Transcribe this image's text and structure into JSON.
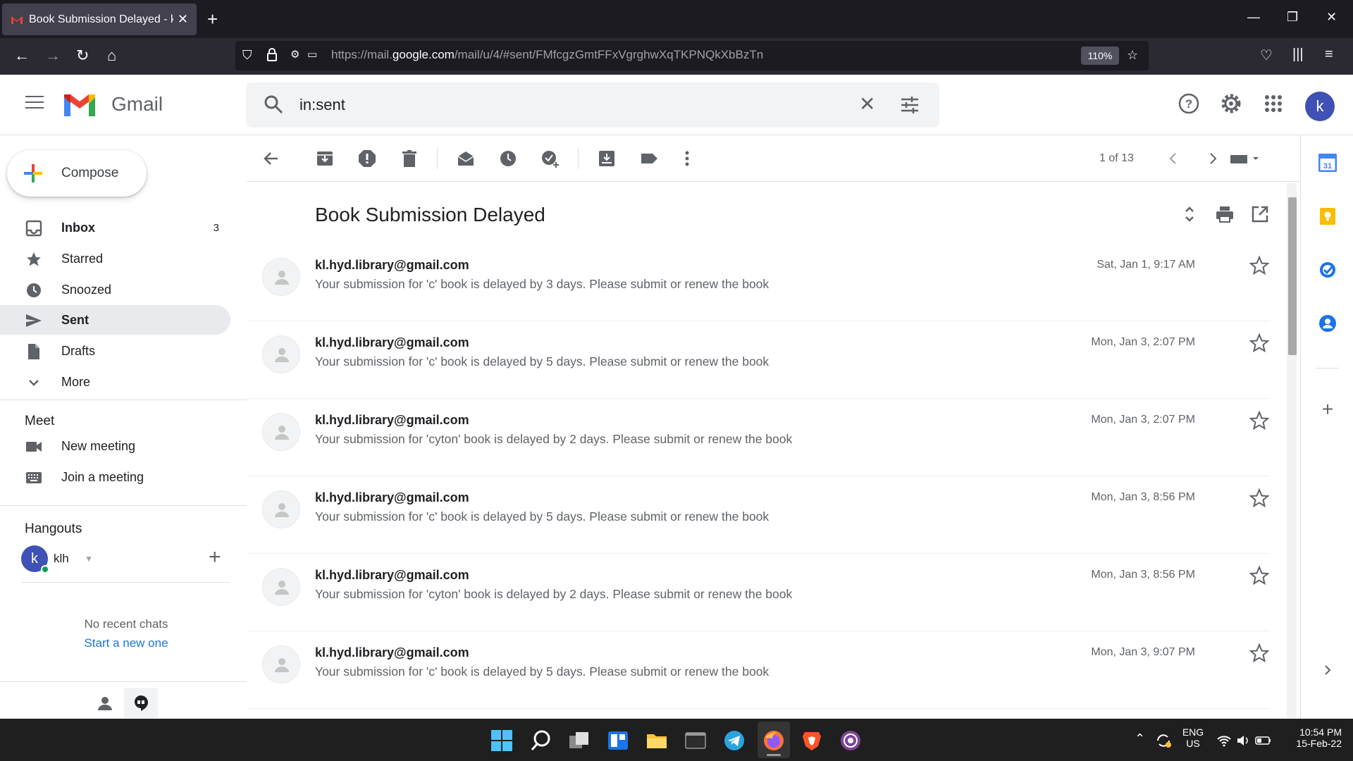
{
  "browser": {
    "tab_title": "Book Submission Delayed - kl.h",
    "url_host_prefix": "https://mail.",
    "url_host": "google.com",
    "url_path": "/mail/u/4/#sent/FMfcgzGmtFFxVgrghwXqTKPNQkXbBzTn",
    "zoom": "110%"
  },
  "gmail": {
    "app_name": "Gmail",
    "search_value": "in:sent",
    "avatar_letter": "k"
  },
  "compose_label": "Compose",
  "nav": [
    {
      "label": "Inbox",
      "count": "3",
      "icon": "inbox-icon"
    },
    {
      "label": "Starred",
      "count": "",
      "icon": "star-icon"
    },
    {
      "label": "Snoozed",
      "count": "",
      "icon": "clock-icon"
    },
    {
      "label": "Sent",
      "count": "",
      "icon": "send-icon"
    },
    {
      "label": "Drafts",
      "count": "",
      "icon": "draft-icon"
    },
    {
      "label": "More",
      "count": "",
      "icon": "chevron-down-icon"
    }
  ],
  "meet": {
    "heading": "Meet",
    "new_meeting": "New meeting",
    "join_meeting": "Join a meeting"
  },
  "hangouts": {
    "heading": "Hangouts",
    "user_name": "klh",
    "user_letter": "k",
    "no_recent": "No recent chats",
    "start_new": "Start a new one"
  },
  "toolbar": {
    "pager": "1 of 13"
  },
  "thread": {
    "subject": "Book Submission Delayed",
    "messages": [
      {
        "from": "kl.hyd.library@gmail.com",
        "snippet": "Your submission for 'c' book is delayed by 3 days. Please submit or renew the book",
        "date": "Sat, Jan 1, 9:17 AM"
      },
      {
        "from": "kl.hyd.library@gmail.com",
        "snippet": "Your submission for 'c' book is delayed by 5 days. Please submit or renew the book",
        "date": "Mon, Jan 3, 2:07 PM"
      },
      {
        "from": "kl.hyd.library@gmail.com",
        "snippet": "Your submission for 'cyton' book is delayed by 2 days. Please submit or renew the book",
        "date": "Mon, Jan 3, 2:07 PM"
      },
      {
        "from": "kl.hyd.library@gmail.com",
        "snippet": "Your submission for 'c' book is delayed by 5 days. Please submit or renew the book",
        "date": "Mon, Jan 3, 8:56 PM"
      },
      {
        "from": "kl.hyd.library@gmail.com",
        "snippet": "Your submission for 'cyton' book is delayed by 2 days. Please submit or renew the book",
        "date": "Mon, Jan 3, 8:56 PM"
      },
      {
        "from": "kl.hyd.library@gmail.com",
        "snippet": "Your submission for 'c' book is delayed by 5 days. Please submit or renew the book",
        "date": "Mon, Jan 3, 9:07 PM"
      }
    ]
  },
  "taskbar": {
    "lang": "ENG",
    "region": "US",
    "time": "10:54 PM",
    "date": "15-Feb-22"
  },
  "colors": {
    "gmail_red": "#ea4335",
    "gmail_blue": "#4285f4",
    "gmail_green": "#34a853",
    "gmail_yellow": "#fbbc04",
    "link_blue": "#1a73e8"
  }
}
